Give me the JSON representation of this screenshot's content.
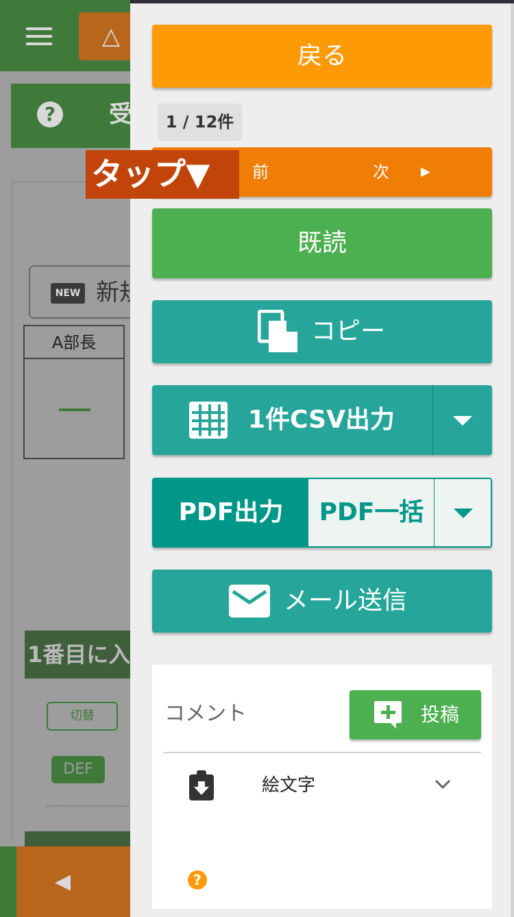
{
  "background_page": {
    "help_text": "受",
    "new_button_badge": "NEW",
    "new_button_text": "新規",
    "table_header": "A部長",
    "first_section_title": "1番目に入",
    "switch_label": "切替",
    "def_badge": "DEF"
  },
  "drawer": {
    "back_label": "戻る",
    "counter": "1 / 12件",
    "prev_label": "前",
    "next_label": "次",
    "tap_overlay": "タップ▼",
    "read_label": "既読",
    "copy_label": "コピー",
    "csv_label": "1件CSV出力",
    "pdf_out_label": "PDF出力",
    "pdf_bulk_label": "PDF一括",
    "mail_label": "メール送信",
    "comment": {
      "title": "コメント",
      "post_label": "投稿",
      "emoji_label": "絵文字"
    }
  },
  "colors": {
    "orange": "#ff9a07",
    "dark_orange": "#f07d04",
    "green": "#4caf50",
    "teal": "#26a69a",
    "pdf_teal": "#009688",
    "tap_red": "#c1440b"
  },
  "icons": [
    "hamburger-icon",
    "warning-icon",
    "help-icon",
    "copy-icon",
    "grid-icon",
    "caret-down-icon",
    "mail-icon",
    "comment-add-icon",
    "clipboard-download-icon",
    "chevron-down-icon",
    "chevron-left-icon",
    "chevron-right-icon"
  ]
}
